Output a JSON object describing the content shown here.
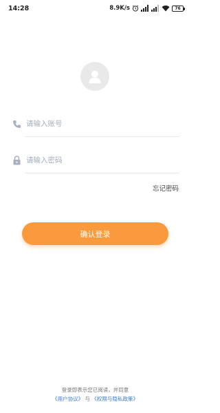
{
  "status_bar": {
    "time": "14:28",
    "network_speed": "8.9K/s",
    "battery_level": "76",
    "icons": [
      "alarm-icon",
      "signal-icon",
      "signal-icon",
      "wifi-icon",
      "battery-icon"
    ]
  },
  "login": {
    "avatar_icon": "user-icon",
    "account_placeholder": "请输入账号",
    "account_value": "",
    "account_icon": "phone-icon",
    "password_placeholder": "请输入密码",
    "password_value": "",
    "password_icon": "lock-icon",
    "forgot_label": "忘记密码",
    "confirm_label": "确认登录"
  },
  "agreement": {
    "prefix": "登录即表示您已阅读，并同意",
    "user_agreement": "《用户协议》",
    "conjunction": "与",
    "privacy_policy": "《权限与隐私政策》"
  },
  "colors": {
    "accent": "#fb9a3c",
    "link": "#3a7bd5",
    "placeholder": "#a6adbb"
  }
}
